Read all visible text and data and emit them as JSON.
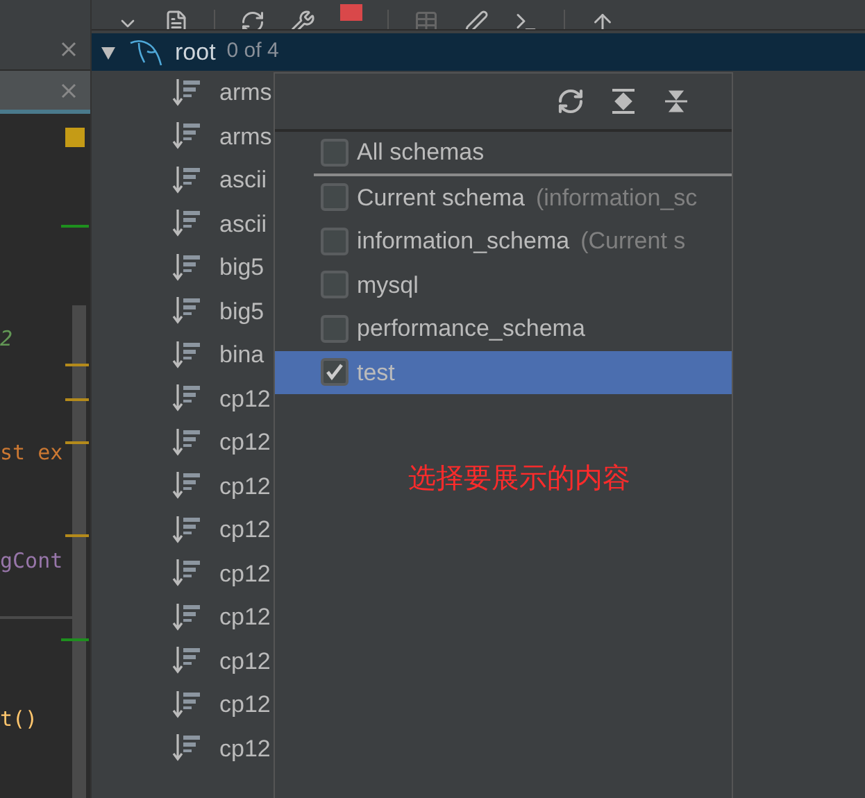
{
  "editor": {
    "tabs": [
      {
        "selected": false
      },
      {
        "selected": true
      }
    ],
    "code_lines": [
      {
        "text": "2",
        "kind": "comment"
      },
      {
        "text": "st ex",
        "kind": "keyword"
      },
      {
        "text": "gCont",
        "kind": "type"
      },
      {
        "text": "t()",
        "kind": "call"
      }
    ]
  },
  "tree": {
    "root": {
      "label": "root",
      "count": "0 of 4",
      "expanded": true,
      "selected": true
    },
    "items": [
      {
        "label": "arms",
        "selected": false
      },
      {
        "label": "arms",
        "selected": false
      },
      {
        "label": "ascii",
        "selected": false
      },
      {
        "label": "ascii",
        "selected": false
      },
      {
        "label": "big5",
        "selected": false
      },
      {
        "label": "big5",
        "selected": false
      },
      {
        "label": "bina",
        "selected": false
      },
      {
        "label": "cp12",
        "selected": false
      },
      {
        "label": "cp12",
        "selected": false
      },
      {
        "label": "cp12",
        "selected": false
      },
      {
        "label": "cp12",
        "selected": false
      },
      {
        "label": "cp12",
        "selected": false
      },
      {
        "label": "cp12",
        "selected": false
      },
      {
        "label": "cp12",
        "selected": false
      },
      {
        "label": "cp12",
        "selected": false
      },
      {
        "label": "cp12",
        "selected": false
      }
    ]
  },
  "schema_popup": {
    "items": [
      {
        "name": "All schemas",
        "checked": false,
        "selected": false
      },
      {
        "name": "Current schema",
        "note": "(information_sc",
        "checked": false,
        "selected": false
      },
      {
        "name": "information_schema",
        "note": "(Current s",
        "checked": false,
        "selected": false
      },
      {
        "name": "mysql",
        "checked": false,
        "selected": false
      },
      {
        "name": "performance_schema",
        "checked": false,
        "selected": false
      },
      {
        "name": "test",
        "checked": true,
        "selected": true
      }
    ],
    "annotation": "选择要展示的内容"
  }
}
